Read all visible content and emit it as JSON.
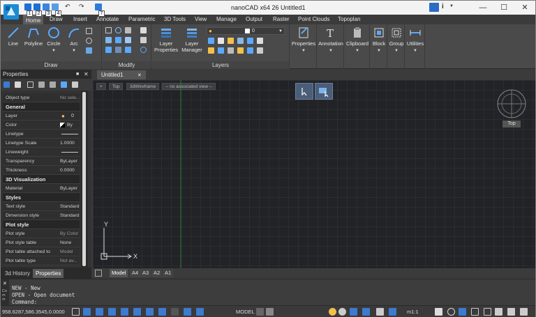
{
  "window": {
    "title": "nanoCAD x64 26 Untitled1",
    "minimize": "—",
    "maximize": "☐",
    "close": "✕",
    "info": "i"
  },
  "qat": {
    "numbers": [
      "1",
      "2",
      "3",
      "4",
      "7"
    ]
  },
  "ribbon_tabs": [
    "Home",
    "Draw",
    "Insert",
    "Annotate",
    "Parametric",
    "3D Tools",
    "View",
    "Manage",
    "Output",
    "Raster",
    "Point Clouds",
    "Topoplan"
  ],
  "ribbon": {
    "draw": {
      "label": "Draw",
      "buttons": [
        "Line",
        "Polyline",
        "Circle",
        "Arc"
      ]
    },
    "modify": {
      "label": "Modify"
    },
    "layers": {
      "label": "Layers",
      "buttons": [
        "Layer Properties",
        "Layer Manager"
      ],
      "layer_combo": "0"
    },
    "right": [
      "Properties",
      "Annotation",
      "Clipboard",
      "Block",
      "Group",
      "Utilities"
    ]
  },
  "properties": {
    "title": "Properties",
    "pin": "📌",
    "close": "✕",
    "rows": [
      {
        "k": "Object type",
        "v": "No sele..."
      },
      {
        "k": "General",
        "v": "",
        "section": true
      },
      {
        "k": "Layer",
        "v": "0"
      },
      {
        "k": "Color",
        "v": "By L..."
      },
      {
        "k": "Linetype",
        "v": ""
      },
      {
        "k": "Linetype Scale",
        "v": "1.0000"
      },
      {
        "k": "Lineweight",
        "v": ""
      },
      {
        "k": "Transparency",
        "v": "ByLayer"
      },
      {
        "k": "Thickness",
        "v": "0.0000"
      },
      {
        "k": "3D Visualization",
        "v": "",
        "section": true
      },
      {
        "k": "Material",
        "v": "ByLayer"
      },
      {
        "k": "Styles",
        "v": "",
        "section": true
      },
      {
        "k": "Text style",
        "v": "Standard"
      },
      {
        "k": "Dimension style",
        "v": "Standard"
      },
      {
        "k": "Plot style",
        "v": "",
        "section": true
      },
      {
        "k": "Plot style",
        "v": "By Color"
      },
      {
        "k": "Plot style table",
        "v": "None"
      },
      {
        "k": "Plot table attached to",
        "v": "Model"
      },
      {
        "k": "Plot table type",
        "v": "Not av..."
      }
    ],
    "tabs": [
      "3d History",
      "Properties"
    ]
  },
  "document": {
    "tab": "Untitled1",
    "tab_close": "✕",
    "view_buttons": [
      "+",
      "Top",
      "3dWireframe",
      "-- no associated view --"
    ],
    "viewcube_label": "Top",
    "ucs_x": "X",
    "ucs_y": "Y",
    "layout_tabs": [
      "Model",
      "A4",
      "A3",
      "A2",
      "A1"
    ]
  },
  "command": {
    "lines": [
      "NEW - New",
      "OPEN - Open document",
      "Command:"
    ],
    "side_label": "Com m"
  },
  "status": {
    "coords": "958.6287,586.3545,0.0000",
    "model": "MODEL",
    "scale": "m1:1"
  }
}
